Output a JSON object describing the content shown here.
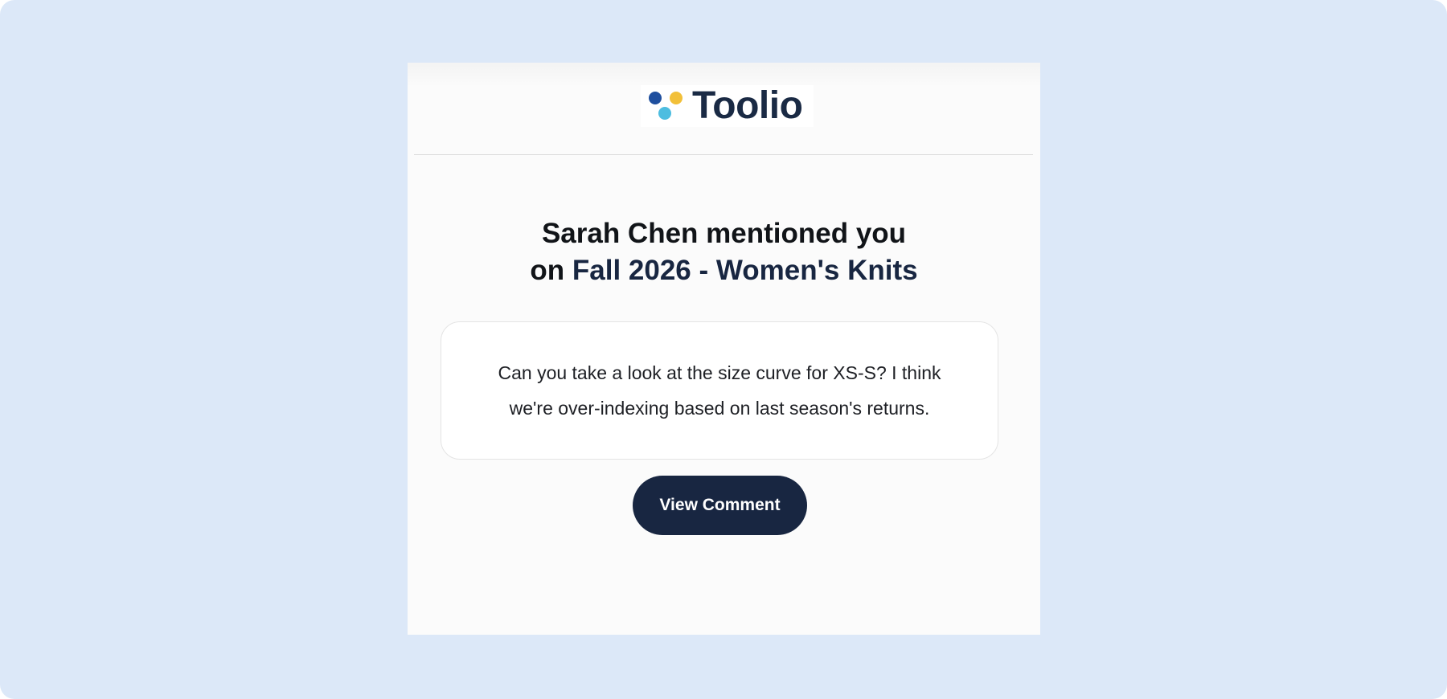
{
  "brand": {
    "name": "Toolio",
    "logo_icon": "three-dots-logo-icon",
    "dot_colors": [
      "#1f4f9e",
      "#f2c039",
      "#4dbde0"
    ]
  },
  "headline": {
    "prefix_line1": "Sarah Chen mentioned you",
    "prefix_line2": "on",
    "document_name": "Fall 2026 - Women's Knits"
  },
  "comment": {
    "text": "Can you take a look at the size curve for XS-S? I think we're over-indexing based on last season's returns."
  },
  "cta": {
    "label": "View Comment"
  },
  "colors": {
    "background": "#dce8f8",
    "email_background": "#fbfbfb",
    "accent_navy": "#182641",
    "card_border": "#e4e4e4"
  }
}
